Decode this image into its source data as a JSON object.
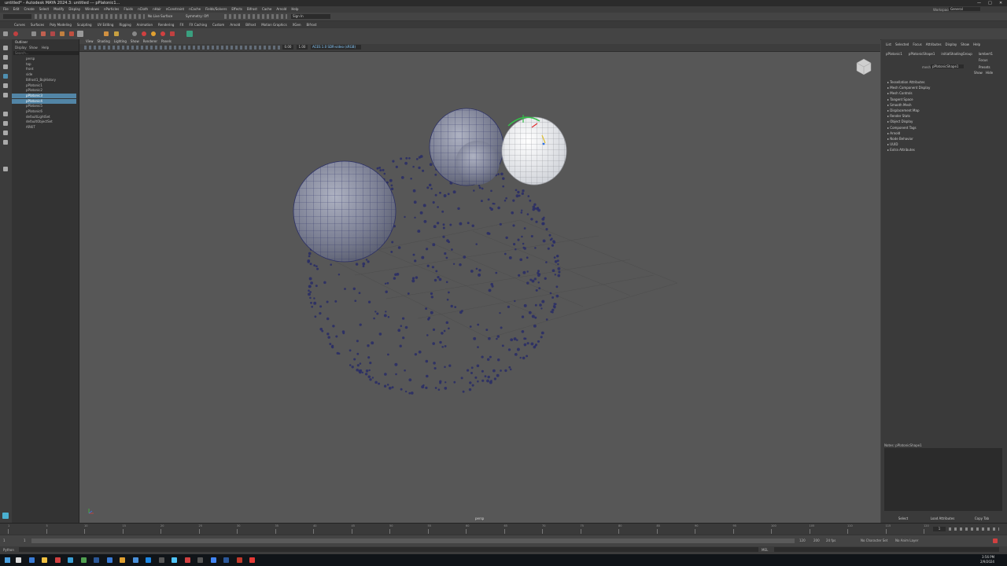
{
  "window": {
    "title": "untitled* - Autodesk MAYA 2024.3: untitled --- pPlatonic1...",
    "controls": [
      "—",
      "□",
      "✕"
    ]
  },
  "menubar": {
    "items": [
      "File",
      "Edit",
      "Create",
      "Select",
      "Modify",
      "Display",
      "Windows",
      "nParticles",
      "Fluids",
      "nCloth",
      "nHair",
      "nConstraint",
      "nCache",
      "Fields/Solvers",
      "Effects",
      "Bifrost",
      "Cache",
      "Arnold",
      "Help"
    ],
    "workspace_label": "Workspace:",
    "workspace_value": "General"
  },
  "statusline": {
    "field1": "No Live Surface",
    "field2": "Symmetry: Off",
    "field3": "Sign In"
  },
  "shelf_tabs": [
    "Curves",
    "Surfaces",
    "Poly Modeling",
    "Sculpting",
    "UV Editing",
    "Rigging",
    "Animation",
    "Rendering",
    "FX",
    "FX Caching",
    "Custom",
    "Arnold",
    "Bifrost",
    "Motion Graphics",
    "XGen",
    "Bifrost"
  ],
  "outliner": {
    "title": "Outliner",
    "menus": [
      "Display",
      "Show",
      "Help"
    ],
    "search_placeholder": "Search...",
    "items": [
      {
        "label": "persp",
        "selected": false
      },
      {
        "label": "top",
        "selected": false
      },
      {
        "label": "front",
        "selected": false
      },
      {
        "label": "side",
        "selected": false
      },
      {
        "label": "Bifrost1_BojHistory",
        "selected": false
      },
      {
        "label": "pPlatonic1",
        "selected": false
      },
      {
        "label": "pPlatonic2",
        "selected": false
      },
      {
        "label": "pPlatonic3",
        "selected": true
      },
      {
        "label": "pPlatonic4",
        "selected": true
      },
      {
        "label": "pPlatonic5",
        "selected": false
      },
      {
        "label": "pPlatonic6",
        "selected": false
      },
      {
        "label": "defaultLightSet",
        "selected": false
      },
      {
        "label": "defaultObjectSet",
        "selected": false
      },
      {
        "label": "ARKIT",
        "selected": false
      }
    ]
  },
  "viewport": {
    "menus": [
      "View",
      "Shading",
      "Lighting",
      "Show",
      "Renderer",
      "Panels"
    ],
    "field_a": "0.00",
    "field_b": "1.00",
    "colorspace": "ACES 1.0 SDR-video (sRGB)",
    "persp_label": "persp"
  },
  "attribute_editor": {
    "tabs": [
      "List",
      "Selected",
      "Focus",
      "Attributes",
      "Display",
      "Show",
      "Help"
    ],
    "node_tabs": [
      "pPlatonic1",
      "pPlatonicShape1",
      "initialShadingGroup",
      "lambert1"
    ],
    "shape_label": "mesh:",
    "shape_value": "pPlatonicShape1",
    "focus_btn": "Focus",
    "presets_btn": "Presets",
    "show_btn": "Show",
    "hide_btn": "Hide",
    "sections": [
      "Tessellation Attributes",
      "Mesh Component Display",
      "Mesh Controls",
      "Tangent Space",
      "Smooth Mesh",
      "Displacement Map",
      "Render Stats",
      "Object Display",
      "Component Tags",
      "Arnold",
      "Node Behavior",
      "UUID",
      "Extra Attributes"
    ],
    "notes_label": "Notes: pPlatonicShape1",
    "bottom_buttons": [
      "Select",
      "Load Attributes",
      "Copy Tab"
    ]
  },
  "timeline": {
    "ticks": [
      "1",
      "5",
      "10",
      "15",
      "20",
      "25",
      "30",
      "35",
      "40",
      "45",
      "50",
      "55",
      "60",
      "65",
      "70",
      "75",
      "80",
      "85",
      "90",
      "95",
      "100",
      "105",
      "110",
      "115",
      "120"
    ],
    "current_frame": "1"
  },
  "range": {
    "start": "1",
    "start2": "1",
    "end": "120",
    "end2": "200",
    "fps": "24 fps",
    "character_set": "No Character Set",
    "anim_layer": "No Anim Layer"
  },
  "helpline": {
    "left_label": "Python",
    "lang": "MEL"
  },
  "taskbar": {
    "clock_time": "3:56 PM",
    "clock_date": "2/9/2024"
  },
  "colors": {
    "selection": "#5285a6",
    "mesh": "#2b2f66",
    "viewport_bg": "#575757"
  }
}
